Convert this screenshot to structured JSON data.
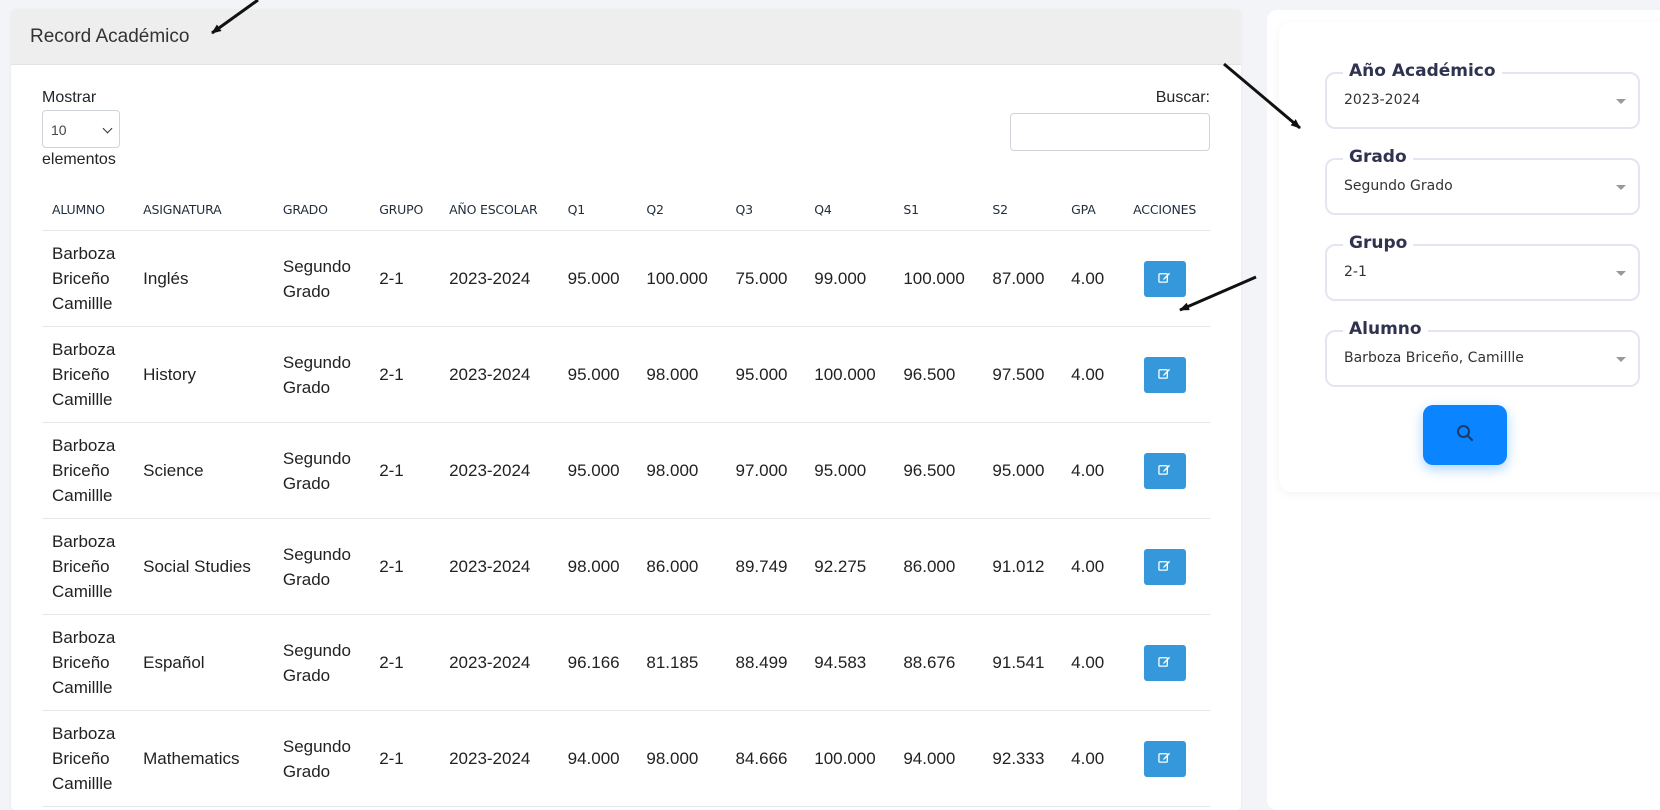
{
  "record": {
    "title": "Record Académico",
    "length_label_top": "Mostrar",
    "length_value": "10",
    "length_label_bottom": "elementos",
    "search_label": "Buscar:",
    "columns": [
      "ALUMNO",
      "ASIGNATURA",
      "GRADO",
      "GRUPO",
      "AÑO ESCOLAR",
      "Q1",
      "Q2",
      "Q3",
      "Q4",
      "S1",
      "S2",
      "GPA",
      "ACCIONES"
    ],
    "rows": [
      {
        "alumno": [
          "Barboza",
          "Briceño",
          "Camillle"
        ],
        "asignatura": "Inglés",
        "grado": [
          "Segundo",
          "Grado"
        ],
        "grupo": "2-1",
        "anio": "2023-2024",
        "q1": "95.000",
        "q2": "100.000",
        "q3": "75.000",
        "q4": "99.000",
        "s1": "100.000",
        "s2": "87.000",
        "gpa": "4.00"
      },
      {
        "alumno": [
          "Barboza",
          "Briceño",
          "Camillle"
        ],
        "asignatura": "History",
        "grado": [
          "Segundo",
          "Grado"
        ],
        "grupo": "2-1",
        "anio": "2023-2024",
        "q1": "95.000",
        "q2": "98.000",
        "q3": "95.000",
        "q4": "100.000",
        "s1": "96.500",
        "s2": "97.500",
        "gpa": "4.00"
      },
      {
        "alumno": [
          "Barboza",
          "Briceño",
          "Camillle"
        ],
        "asignatura": "Science",
        "grado": [
          "Segundo",
          "Grado"
        ],
        "grupo": "2-1",
        "anio": "2023-2024",
        "q1": "95.000",
        "q2": "98.000",
        "q3": "97.000",
        "q4": "95.000",
        "s1": "96.500",
        "s2": "95.000",
        "gpa": "4.00"
      },
      {
        "alumno": [
          "Barboza",
          "Briceño",
          "Camillle"
        ],
        "asignatura": "Social Studies",
        "grado": [
          "Segundo",
          "Grado"
        ],
        "grupo": "2-1",
        "anio": "2023-2024",
        "q1": "98.000",
        "q2": "86.000",
        "q3": "89.749",
        "q4": "92.275",
        "s1": "86.000",
        "s2": "91.012",
        "gpa": "4.00"
      },
      {
        "alumno": [
          "Barboza",
          "Briceño",
          "Camillle"
        ],
        "asignatura": "Español",
        "grado": [
          "Segundo",
          "Grado"
        ],
        "grupo": "2-1",
        "anio": "2023-2024",
        "q1": "96.166",
        "q2": "81.185",
        "q3": "88.499",
        "q4": "94.583",
        "s1": "88.676",
        "s2": "91.541",
        "gpa": "4.00"
      },
      {
        "alumno": [
          "Barboza",
          "Briceño",
          "Camillle"
        ],
        "asignatura": "Mathematics",
        "grado": [
          "Segundo",
          "Grado"
        ],
        "grupo": "2-1",
        "anio": "2023-2024",
        "q1": "94.000",
        "q2": "98.000",
        "q3": "84.666",
        "q4": "100.000",
        "s1": "94.000",
        "s2": "92.333",
        "gpa": "4.00"
      }
    ],
    "action_icon": "edit-icon",
    "action_color": "#3498db"
  },
  "filters": {
    "anio": {
      "label": "Año Académico",
      "value": "2023-2024"
    },
    "grado": {
      "label": "Grado",
      "value": "Segundo Grado"
    },
    "grupo": {
      "label": "Grupo",
      "value": "2-1"
    },
    "alumno": {
      "label": "Alumno",
      "value": "Barboza Briceño, Camillle"
    },
    "search_icon": "search-icon",
    "button_color": "#0a84ff"
  }
}
